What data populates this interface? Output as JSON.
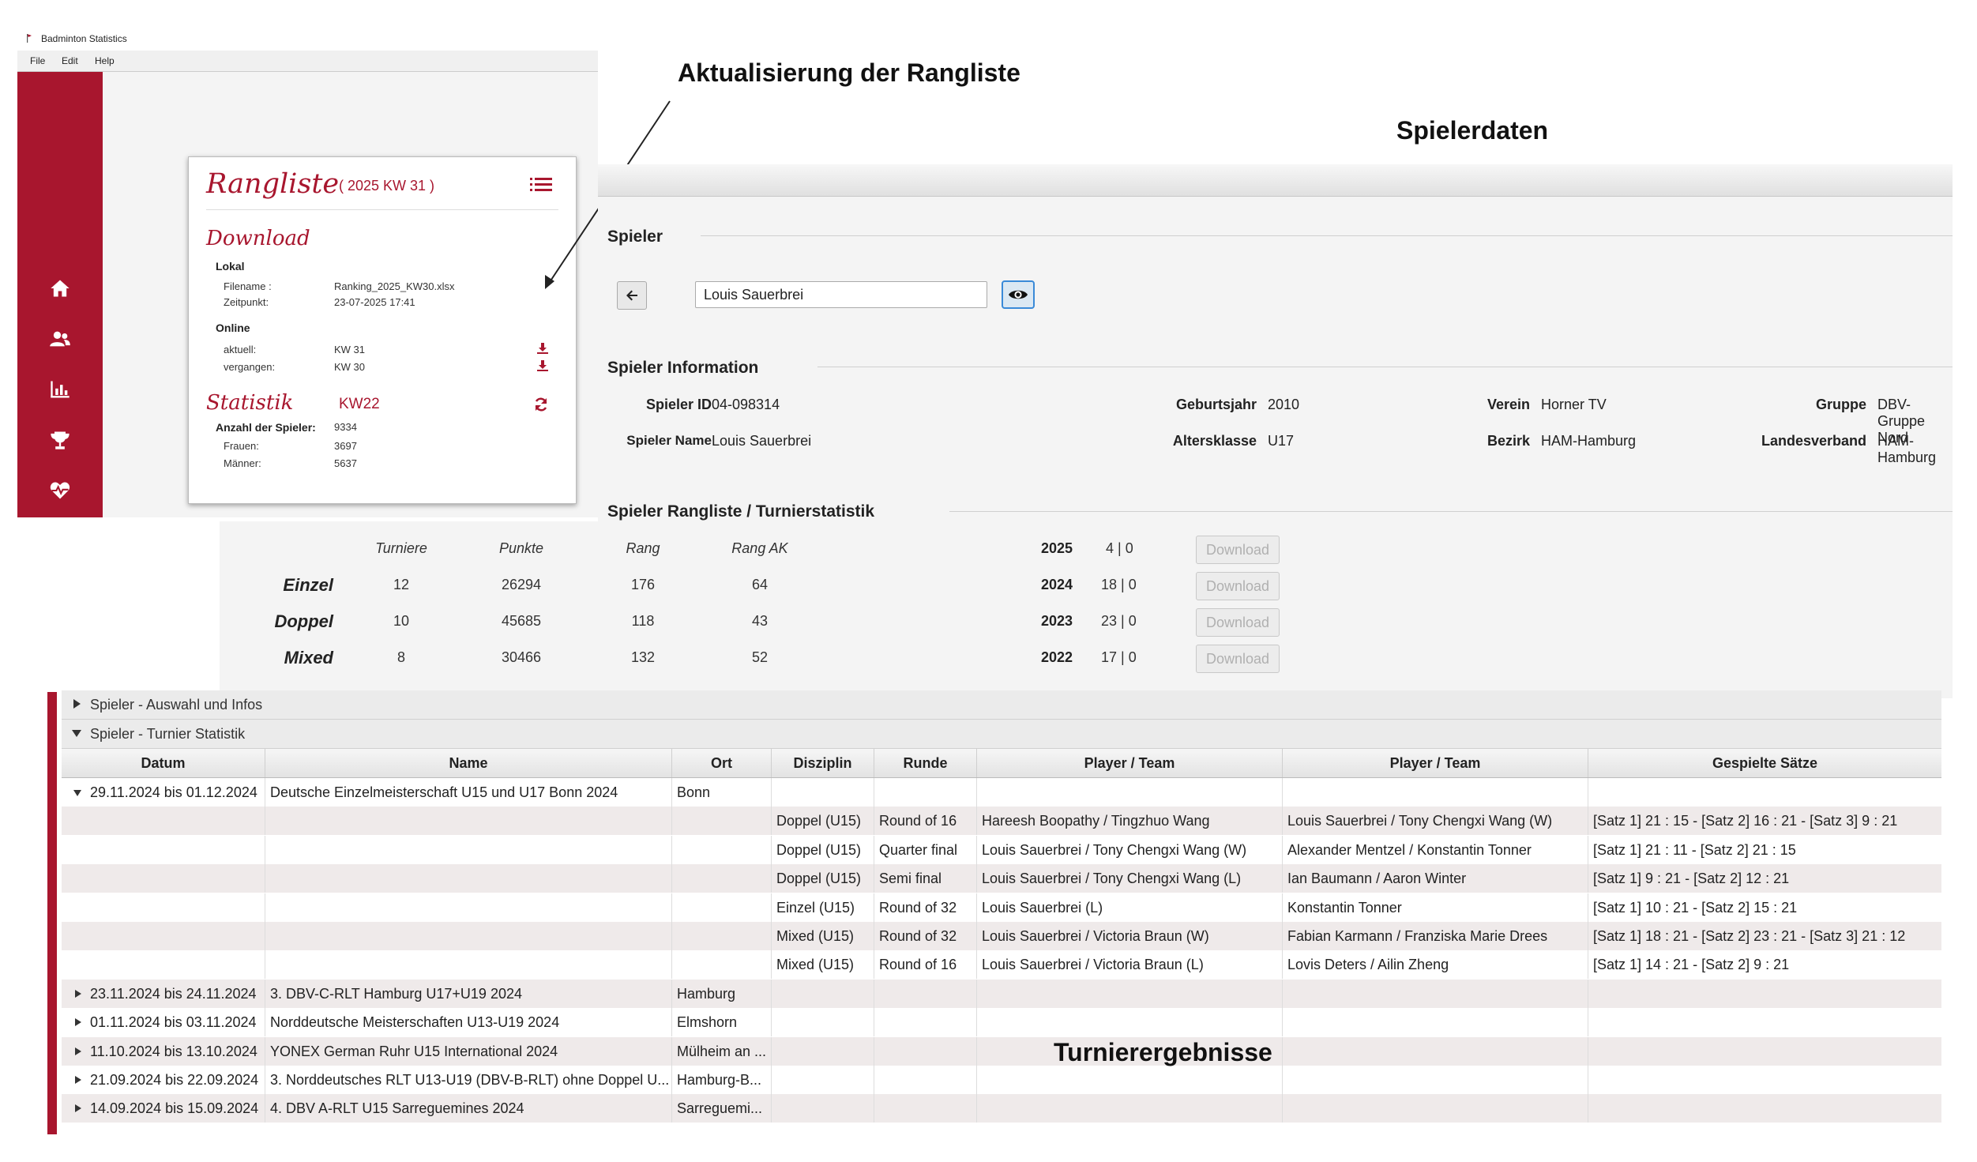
{
  "app": {
    "title": "Badminton Statistics",
    "menu": [
      "File",
      "Edit",
      "Help"
    ],
    "nav_icons": [
      "home-icon",
      "users-icon",
      "bar-chart-icon",
      "trophy-icon",
      "heartbeat-icon"
    ],
    "accent": "#a8162e"
  },
  "rangliste": {
    "title": "Rangliste",
    "week": "( 2025 KW 31 )",
    "download_heading": "Download",
    "lokal_heading": "Lokal",
    "filename_label": "Filename :",
    "filename_value": "Ranking_2025_KW30.xlsx",
    "zeitpunkt_label": "Zeitpunkt:",
    "zeitpunkt_value": "23-07-2025 17:41",
    "online_heading": "Online",
    "aktuell_label": "aktuell:",
    "aktuell_value": "KW 31",
    "vergangen_label": "vergangen:",
    "vergangen_value": "KW 30",
    "statistik_heading": "Statistik",
    "statistik_week": "KW22",
    "anzahl_label": "Anzahl der Spieler:",
    "anzahl_value": "9334",
    "frauen_label": "Frauen:",
    "frauen_value": "3697",
    "maenner_label": "Männer:",
    "maenner_value": "5637"
  },
  "annotations": {
    "update": "Aktualisierung der Rangliste",
    "spielerdaten": "Spielerdaten",
    "turnierergebnisse": "Turnierergebnisse"
  },
  "spieler": {
    "section": "Spieler",
    "search_value": "Louis Sauerbrei",
    "info_section": "Spieler Information",
    "info": {
      "id_label": "Spieler  ID",
      "id_value": "04-098314",
      "name_label": "Spieler Name",
      "name_value": "Louis Sauerbrei",
      "geburtsjahr_label": "Geburtsjahr",
      "geburtsjahr_value": "2010",
      "altersklasse_label": "Altersklasse",
      "altersklasse_value": "U17",
      "verein_label": "Verein",
      "verein_value": "Horner TV",
      "bezirk_label": "Bezirk",
      "bezirk_value": "HAM-Hamburg",
      "gruppe_label": "Gruppe",
      "gruppe_value": "DBV-Gruppe Nord",
      "landesverband_label": "Landesverband",
      "landesverband_value": "HAM-Hamburg"
    },
    "stats_section": "Spieler Rangliste / Turnierstatistik",
    "stats_columns": [
      "Turniere",
      "Punkte",
      "Rang",
      "Rang AK"
    ],
    "stats_rows": [
      {
        "name": "Einzel",
        "values": [
          "12",
          "26294",
          "176",
          "64"
        ]
      },
      {
        "name": "Doppel",
        "values": [
          "10",
          "45685",
          "118",
          "43"
        ]
      },
      {
        "name": "Mixed",
        "values": [
          "8",
          "30466",
          "132",
          "52"
        ]
      }
    ],
    "years": [
      {
        "year": "2025",
        "value": "4 | 0",
        "button": "Download"
      },
      {
        "year": "2024",
        "value": "18  | 0",
        "button": "Download"
      },
      {
        "year": "2023",
        "value": "23 | 0",
        "button": "Download"
      },
      {
        "year": "2022",
        "value": "17 | 0",
        "button": "Download"
      }
    ]
  },
  "turniere": {
    "accordion1": "Spieler - Auswahl und Infos",
    "accordion2": "Spieler - Turnier Statistik",
    "columns": [
      "Datum",
      "Name",
      "Ort",
      "Disziplin",
      "Runde",
      "Player / Team",
      "Player / Team",
      "Gespielte Sätze"
    ],
    "rows": [
      {
        "expanded": true,
        "cells": [
          "29.11.2024 bis 01.12.2024",
          "Deutsche Einzelmeisterschaft U15 und U17 Bonn 2024",
          "Bonn",
          "",
          "",
          "",
          "",
          ""
        ]
      },
      {
        "child": true,
        "cells": [
          "",
          "",
          "",
          "Doppel (U15)",
          "Round of 16",
          "Hareesh Boopathy / Tingzhuo Wang",
          "Louis Sauerbrei / Tony Chengxi Wang (W)",
          "[Satz 1] 21 : 15 - [Satz 2] 16 : 21 - [Satz 3]  9 : 21"
        ]
      },
      {
        "child": true,
        "cells": [
          "",
          "",
          "",
          "Doppel (U15)",
          "Quarter final",
          "Louis Sauerbrei / Tony Chengxi Wang (W)",
          "Alexander Mentzel / Konstantin Tonner",
          "[Satz 1] 21 : 11 - [Satz 2] 21 : 15"
        ]
      },
      {
        "child": true,
        "cells": [
          "",
          "",
          "",
          "Doppel (U15)",
          "Semi final",
          "Louis Sauerbrei / Tony Chengxi Wang (L)",
          "Ian Baumann / Aaron Winter",
          "[Satz 1]  9 : 21 - [Satz 2] 12 : 21"
        ]
      },
      {
        "child": true,
        "cells": [
          "",
          "",
          "",
          "Einzel (U15)",
          "Round of 32",
          "Louis Sauerbrei (L)",
          "Konstantin Tonner",
          "[Satz 1] 10 : 21 - [Satz 2] 15 : 21"
        ]
      },
      {
        "child": true,
        "cells": [
          "",
          "",
          "",
          "Mixed (U15)",
          "Round of 32",
          "Louis Sauerbrei / Victoria Braun (W)",
          "Fabian Karmann / Franziska Marie Drees",
          "[Satz 1] 18 : 21 - [Satz 2] 23 : 21 - [Satz 3] 21 : 12"
        ]
      },
      {
        "child": true,
        "cells": [
          "",
          "",
          "",
          "Mixed (U15)",
          "Round of 16",
          "Louis Sauerbrei / Victoria Braun (L)",
          "Lovis Deters / Ailin Zheng",
          "[Satz 1] 14 : 21 - [Satz 2]  9 : 21"
        ]
      },
      {
        "cells": [
          "23.11.2024 bis 24.11.2024",
          "3. DBV-C-RLT Hamburg U17+U19 2024",
          "Hamburg",
          "",
          "",
          "",
          "",
          ""
        ]
      },
      {
        "cells": [
          "01.11.2024 bis 03.11.2024",
          "Norddeutsche Meisterschaften U13-U19 2024",
          "Elmshorn",
          "",
          "",
          "",
          "",
          ""
        ]
      },
      {
        "cells": [
          "11.10.2024 bis 13.10.2024",
          "YONEX German Ruhr U15 International 2024",
          "Mülheim an ...",
          "",
          "",
          "",
          "",
          ""
        ]
      },
      {
        "cells": [
          "21.09.2024 bis 22.09.2024",
          "3. Norddeutsches RLT U13-U19 (DBV-B-RLT) ohne Doppel U...",
          "Hamburg-B...",
          "",
          "",
          "",
          "",
          ""
        ]
      },
      {
        "cells": [
          "14.09.2024 bis 15.09.2024",
          "4. DBV A-RLT U15 Sarreguemines 2024",
          "Sarreguemi...",
          "",
          "",
          "",
          "",
          ""
        ]
      }
    ]
  }
}
